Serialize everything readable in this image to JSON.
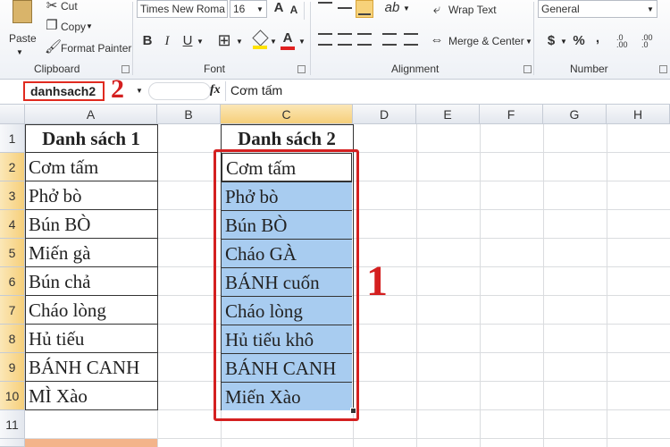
{
  "ribbon": {
    "clipboard": {
      "paste": "Paste",
      "cut": "Cut",
      "copy": "Copy",
      "format_painter": "Format Painter",
      "label": "Clipboard"
    },
    "font": {
      "name": "Times New Roma",
      "size": "16",
      "bold": "B",
      "italic": "I",
      "underline": "U",
      "grow": "A",
      "shrink": "A",
      "font_color": "A",
      "label": "Font"
    },
    "alignment": {
      "wrap": "Wrap Text",
      "merge": "Merge & Center",
      "label": "Alignment"
    },
    "number": {
      "format": "General",
      "currency": "$",
      "percent": "%",
      "comma": ",",
      "label": "Number"
    }
  },
  "formula_bar": {
    "name_box": "danhsach2",
    "fx": "fx",
    "content": "Cơm tấm"
  },
  "annotations": {
    "namebox_num": "2",
    "range_num": "1"
  },
  "columns": [
    "A",
    "B",
    "C",
    "D",
    "E",
    "F",
    "G",
    "H"
  ],
  "rows": [
    "1",
    "2",
    "3",
    "4",
    "5",
    "6",
    "7",
    "8",
    "9",
    "10",
    "11"
  ],
  "list1": {
    "header": "Danh sách 1",
    "items": [
      "Cơm tấm",
      "Phở bò",
      "Bún BÒ",
      "Miến gà",
      "Bún chả",
      "Cháo lòng",
      "Hủ tiếu",
      "BÁNH CANH",
      "MÌ Xào"
    ]
  },
  "list2": {
    "header": "Danh sách 2",
    "items": [
      "Cơm tấm",
      "Phở bò",
      "Bún BÒ",
      "Cháo GÀ",
      "BÁNH cuốn",
      "Cháo lòng",
      "Hủ tiếu khô",
      "BÁNH CANH",
      "Miến Xào"
    ]
  },
  "colors": {
    "selection": "#a8ccf0",
    "annotation": "#d42020",
    "header_selected": "#f6cf7a"
  }
}
